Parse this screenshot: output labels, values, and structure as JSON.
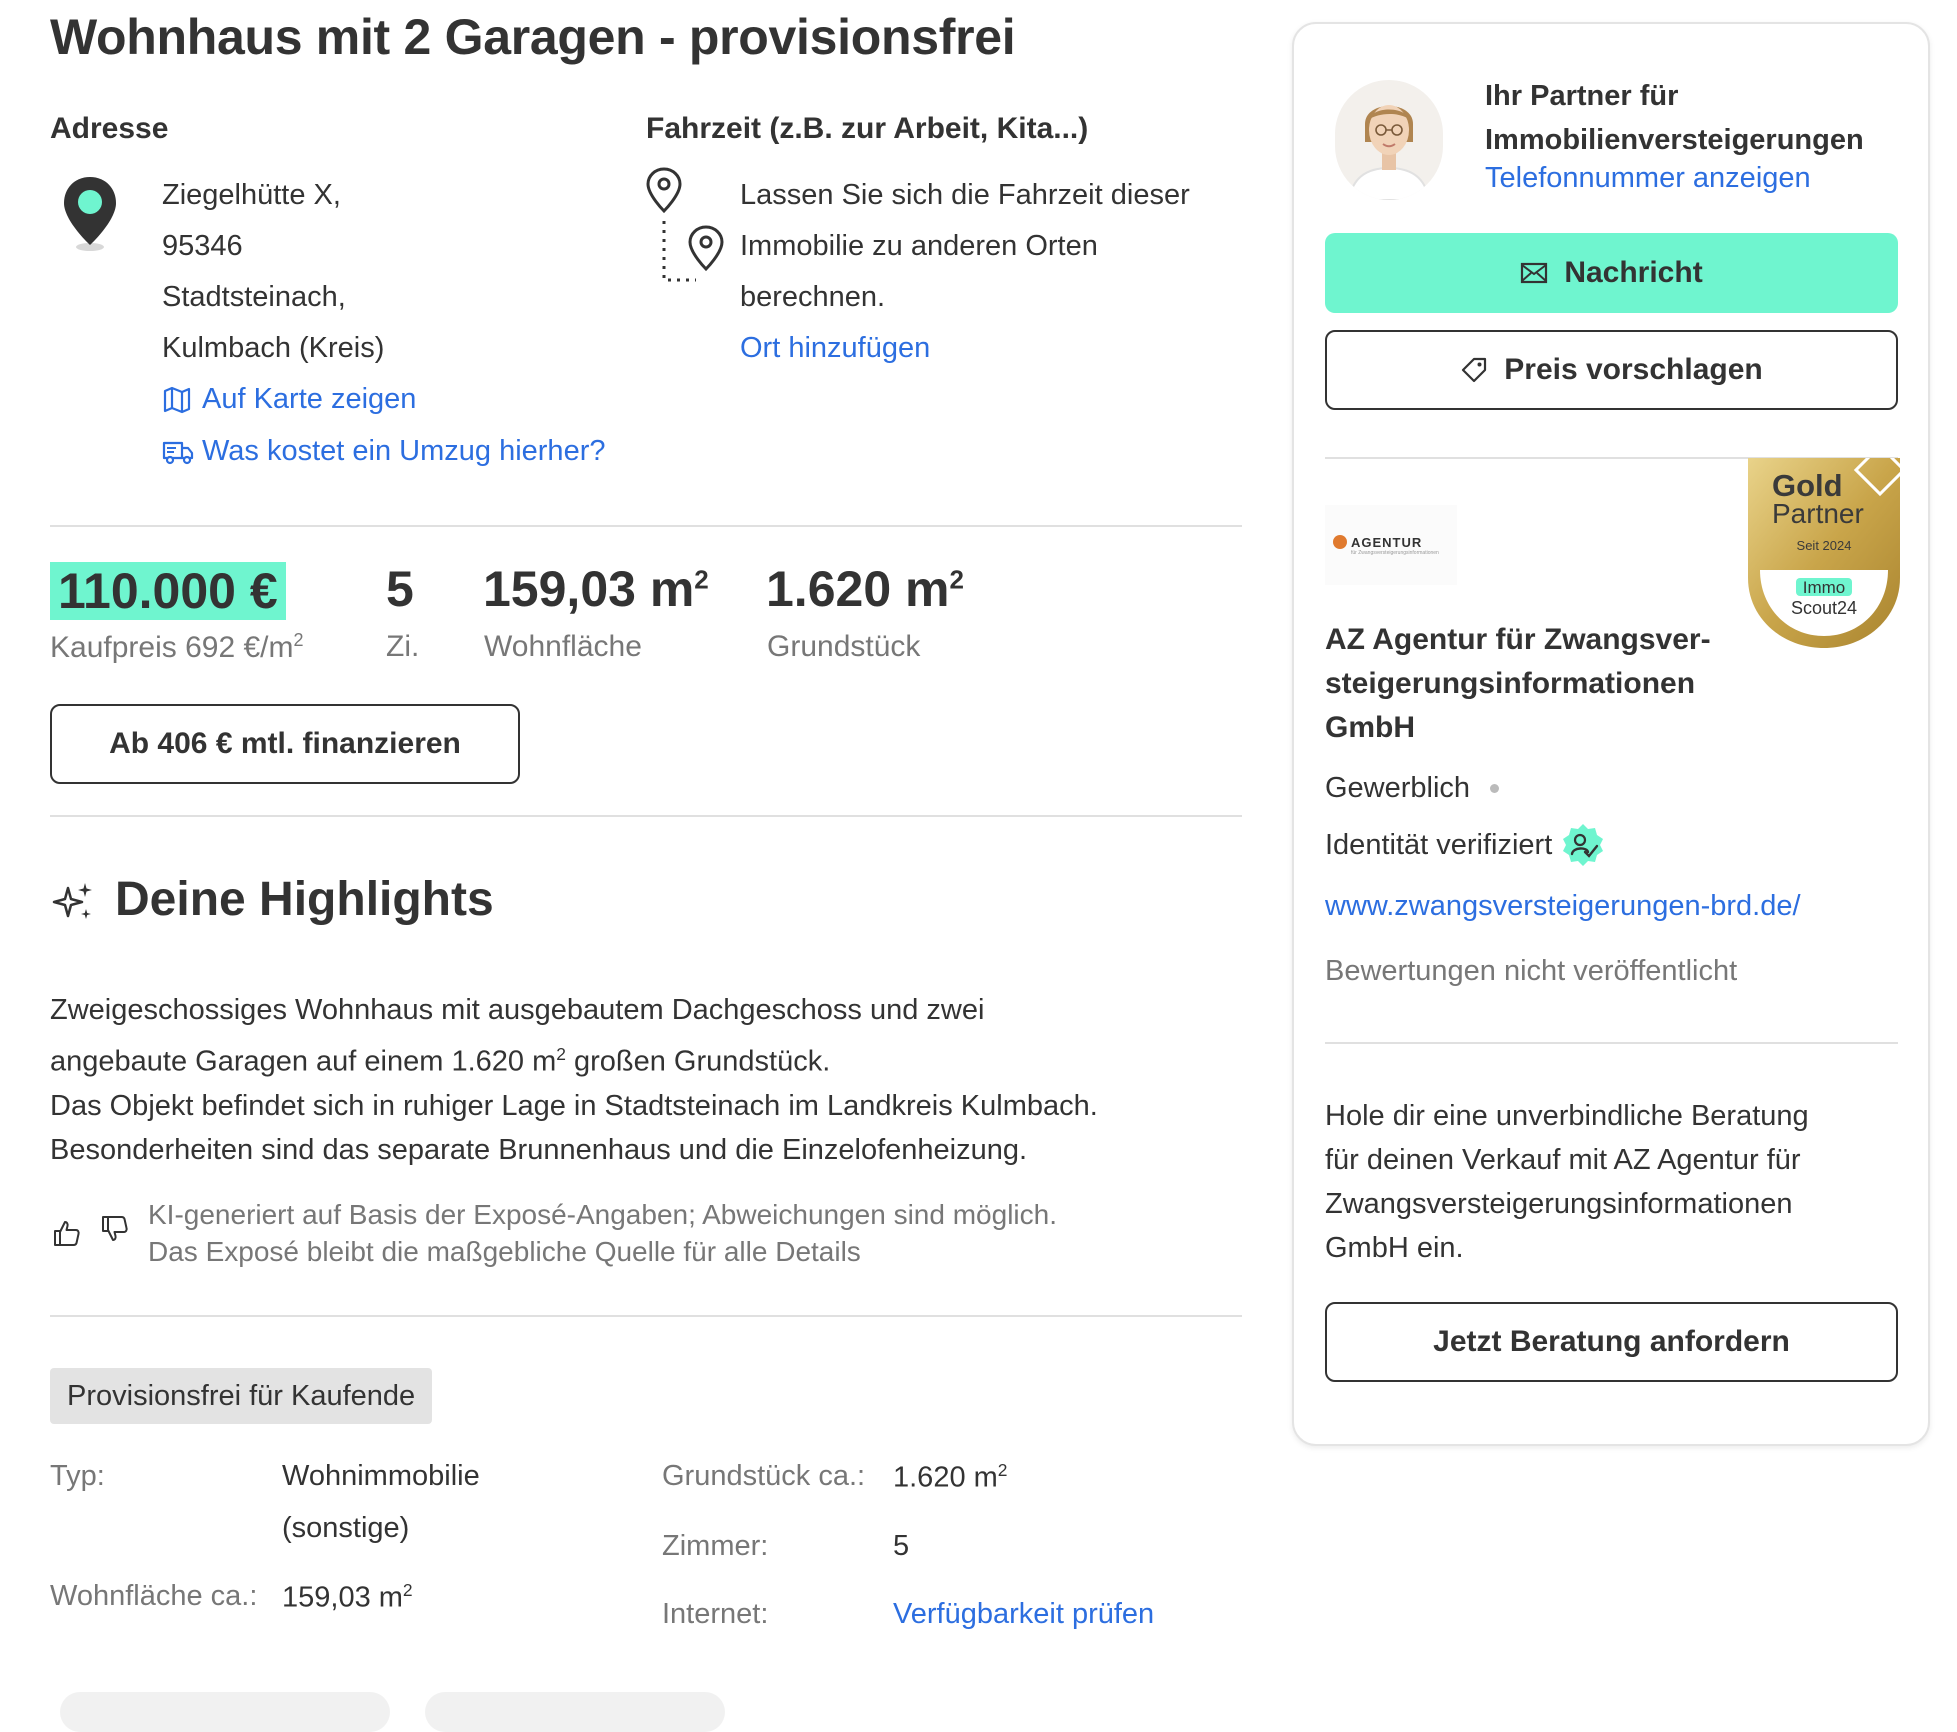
{
  "listing": {
    "title": "Wohnhaus mit 2 Garagen - provisionsfrei"
  },
  "address": {
    "heading": "Adresse",
    "lines": [
      "Ziegelhütte X,",
      "95346",
      "Stadtsteinach,",
      "Kulmbach (Kreis)"
    ],
    "map_link": "Auf Karte zeigen",
    "move_link": "Was kostet ein Umzug hierher?"
  },
  "commute": {
    "heading": "Fahrzeit (z.B. zur Arbeit, Kita...)",
    "lines": [
      "Lassen Sie sich die Fahrzeit dieser",
      "Immobilie zu anderen Orten",
      "berechnen."
    ],
    "add_link": "Ort hinzufügen"
  },
  "key_facts": {
    "price": "110.000 €",
    "price_label": "Kaufpreis 692 €/m",
    "price_label_sup": "2",
    "rooms": "5",
    "rooms_label": "Zi.",
    "living_area": "159,03 m",
    "living_area_sup": "2",
    "living_area_label": "Wohnfläche",
    "plot": "1.620 m",
    "plot_sup": "2",
    "plot_label": "Grundstück",
    "finance_button": "Ab 406 € mtl. finanzieren"
  },
  "highlights": {
    "heading": "Deine Highlights",
    "text_l1": "Zweigeschossiges Wohnhaus mit ausgebautem Dachgeschoss und zwei",
    "text_l2a": "angebaute Garagen auf einem 1.620 m",
    "text_l2sup": "2",
    "text_l2b": " großen Grundstück.",
    "text_l3": "Das Objekt befindet sich in ruhiger Lage in Stadtsteinach im Landkreis Kulmbach.",
    "text_l4": "Besonderheiten sind das separate Brunnenhaus und die Einzelofenheizung.",
    "disclaimer_l1": "KI-generiert auf Basis der Exposé-Angaben; Abweichungen sind möglich.",
    "disclaimer_l2": "Das Exposé bleibt die maßgebliche Quelle für alle Details"
  },
  "details": {
    "badge": "Provisionsfrei für Kaufende",
    "typ_label": "Typ:",
    "typ_value_l1": "Wohnimmobilie",
    "typ_value_l2": "(sonstige)",
    "wohnflaeche_label": "Wohnfläche ca.:",
    "wohnflaeche_value": "159,03 m",
    "wohnflaeche_sup": "2",
    "grundstueck_label": "Grundstück ca.:",
    "grundstueck_value": "1.620 m",
    "grundstueck_sup": "2",
    "zimmer_label": "Zimmer:",
    "zimmer_value": "5",
    "internet_label": "Internet:",
    "internet_link": "Verfügbarkeit prüfen"
  },
  "contact": {
    "partner_l1": "Ihr Partner für",
    "partner_l2": "Immobilienversteigerungen",
    "phone_link": "Telefonnummer anzeigen",
    "message_button": "Nachricht",
    "price_button": "Preis vorschlagen",
    "badge_gold": "Gold",
    "badge_partner": "Partner",
    "badge_since": "Seit 2024",
    "badge_brand_l1": "Immo",
    "badge_brand_l2": "Scout24",
    "logo_text": "AGENTUR",
    "logo_tagline": "für Zwangsversteigerungsinformationen",
    "company_l1": "AZ Agentur für Zwangsver-",
    "company_l2": "steigerungsinformationen",
    "company_l3": "GmbH",
    "type": "Gewerblich",
    "verified": "Identität verifiziert",
    "website": "www.zwangsversteigerungen-brd.de/",
    "ratings": "Bewertungen nicht veröffentlicht",
    "cta_l1": "Hole dir eine unverbindliche Beratung",
    "cta_l2": "für deinen Verkauf mit AZ Agentur für",
    "cta_l3": "Zwangsversteigerungsinformationen",
    "cta_l4": "GmbH ein.",
    "cta_button": "Jetzt Beratung anfordern"
  },
  "colors": {
    "accent": "#6ff5cf",
    "link": "#2c6ee0",
    "text": "#333333",
    "muted": "#777777",
    "gold": "#c9a54a"
  }
}
